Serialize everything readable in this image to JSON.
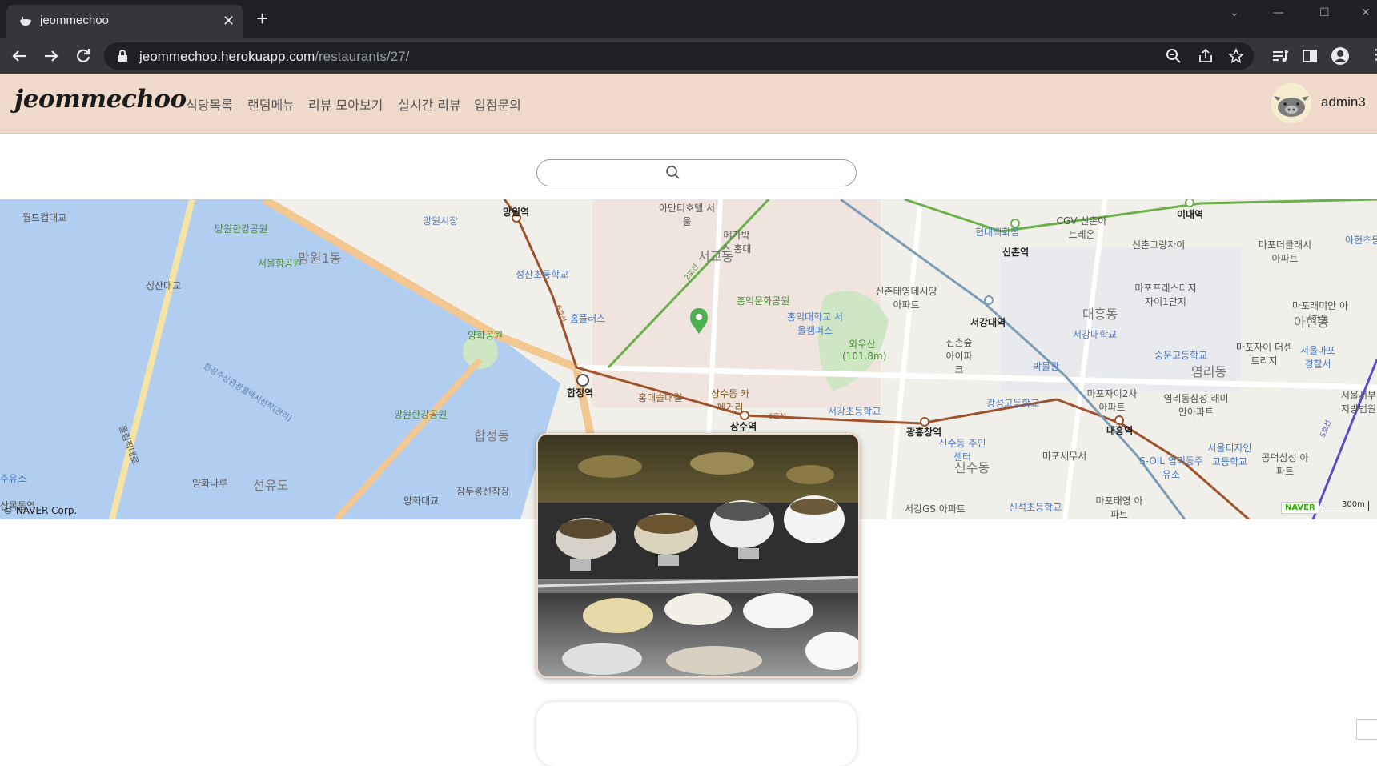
{
  "browser": {
    "tab_title": "jeommechoo",
    "url_host": "jeommechoo.herokuapp.com",
    "url_path": "/restaurants/27/"
  },
  "site": {
    "logo": "jeommechoo",
    "menu": [
      "식당목록",
      "랜덤메뉴",
      "리뷰 모아보기",
      "실시간 리뷰",
      "입점문의"
    ],
    "username": "admin3"
  },
  "search": {
    "placeholder": ""
  },
  "map": {
    "labels": {
      "l1": "월드컵대교",
      "l2": "망원한강공원",
      "l3": "서울함공원",
      "l4": "망원1동",
      "l5": "성산대교",
      "l6": "망원시장",
      "l7": "망원역",
      "l8": "성산초등학교",
      "l9": "홈플러스",
      "l10": "양화공원",
      "l11": "합정역",
      "l12": "홍대솔내길",
      "l13": "망원한강공원",
      "l14": "합정동",
      "l15": "양화나루",
      "l16": "선유도",
      "l17": "양화대교",
      "l18": "잠두봉선착장",
      "l19": "아만티호텔 서울",
      "l20": "메가박스 홍대",
      "l21": "서교동",
      "l22": "홍익문화공원",
      "l23": "홍익대학교 서울캠퍼스",
      "l24": "상수동 카페거리",
      "l25": "상수역",
      "l26": "서강초등학교",
      "l27": "와우산 (101.8m)",
      "l28": "신촌태영데시앙 아파트",
      "l29": "현대백화점",
      "l30": "신촌역",
      "l31": "CGV 신촌아트레온",
      "l32": "이대역",
      "l33": "신촌그랑자이",
      "l34": "서강대역",
      "l35": "대흥동",
      "l36": "서강대학교",
      "l37": "신촌숲 아이파크",
      "l38": "박물관",
      "l39": "광흥창역",
      "l40": "광성고등학교",
      "l41": "신수동 주민센터",
      "l42": "신수동",
      "l43": "마포자이2차 아파트",
      "l44": "대흥역",
      "l45": "마포세무서",
      "l46": "염리동",
      "l47": "마포더클래시 아파트",
      "l48": "마포프레스티지 자이1단지",
      "l49": "마포래미안 아현동",
      "l50": "서울마포 경찰서",
      "l51": "아현동",
      "l52": "공덕삼성 아파트",
      "l53": "서울디자인 고등학교",
      "l54": "S-OIL 염리동주유소",
      "l55": "신석초등학교",
      "l56": "마포태영 아파트",
      "l57": "서강GS 아파트",
      "l58": "숭문고등학교",
      "l59": "마포자이 더센트리지",
      "l60": "염리동삼성 래미안아파트",
      "l61": "한강수상관광콜택시선착(관리)",
      "l62": "올림픽대로",
      "l63": "2호선",
      "l64": "6호선",
      "l65": "6호선",
      "l66": "5호선",
      "l67": "서울서부 지방법원",
      "l68": "아현초등학교",
      "l69": "주유소",
      "l70": "상목동역"
    },
    "copyright": "© NAVER Corp.",
    "naver_badge": "NAVER",
    "scale_label": "300m"
  },
  "colors": {
    "header_bg": "#efd9cb",
    "water": "#b1cdef",
    "pin": "#4caf50"
  }
}
